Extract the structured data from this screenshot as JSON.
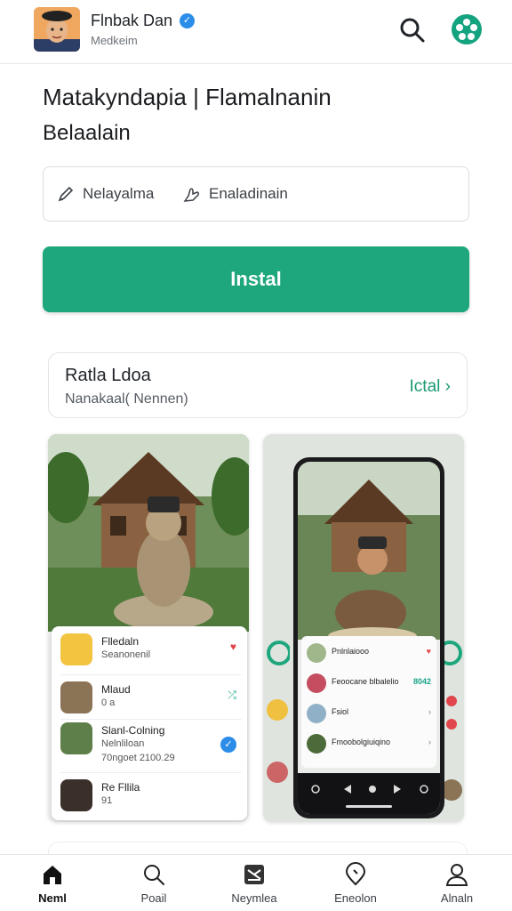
{
  "header": {
    "developer_name": "Flnbak Dan",
    "developer_sub": "Medkeim",
    "verified_glyph": "✓",
    "search_icon": "search-icon",
    "brand_icon": "brand-icon"
  },
  "app": {
    "title_line1": "Matakyndapia | Flamalnanin",
    "title_line2": "Belaalain"
  },
  "chips": [
    {
      "icon": "pen-icon",
      "label": "Nelayalma"
    },
    {
      "icon": "hand-icon",
      "label": "Enaladinain"
    }
  ],
  "install_label": "Instal",
  "info_card": {
    "title": "Ratla Ldoa",
    "subtitle": "Nanakaal( Nennen)",
    "link_label": "Ictal",
    "link_glyph": "›"
  },
  "screenshot_left": {
    "list": [
      {
        "title": "Flledaln",
        "sub": "Seanonenil",
        "action": "♥",
        "action_color": "#e0464b"
      },
      {
        "title": "Mlaud",
        "sub": "0 a",
        "action": "⤮",
        "action_color": "#1aa38a"
      },
      {
        "title": "Slanl-Colning",
        "sub": "Nelnliloan",
        "meta": "70ngoet 2100.29",
        "action": "✓",
        "action_color": "#2b8de8"
      },
      {
        "title": "Re Fllila",
        "sub": "91",
        "action": "",
        "action_color": "#555555"
      }
    ]
  },
  "screenshot_right": {
    "list": [
      {
        "label": "Pnlnlaiooo",
        "action": "♥",
        "action_color": "#e0464b"
      },
      {
        "label": "Feoocane blbalelio",
        "action": "8042",
        "action_color": "#1aa38a"
      },
      {
        "label": "Fsiol",
        "action": "›",
        "action_color": "#777777"
      },
      {
        "label": "Fmoobolgiuiqino",
        "action": "›",
        "action_color": "#777777"
      }
    ]
  },
  "bottom_nav": [
    {
      "icon": "home-icon",
      "label": "Neml",
      "active": true
    },
    {
      "icon": "search-icon",
      "label": "Poail",
      "active": false
    },
    {
      "icon": "mail-icon",
      "label": "Neymlea",
      "active": false
    },
    {
      "icon": "location-icon",
      "label": "Eneolon",
      "active": false
    },
    {
      "icon": "profile-icon",
      "label": "Alnaln",
      "active": false
    }
  ],
  "colors": {
    "accent": "#1ea77d",
    "link": "#1a9a72",
    "verified": "#2b8de8"
  }
}
